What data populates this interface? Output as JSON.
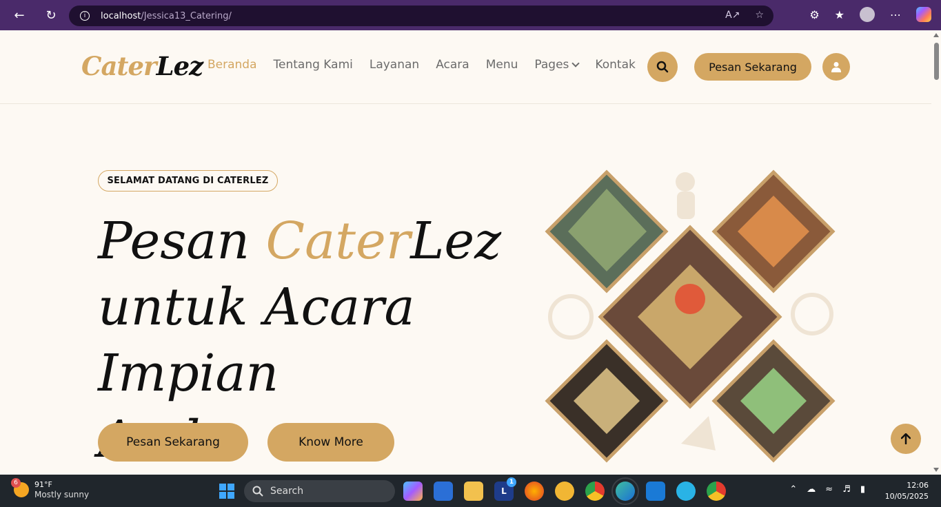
{
  "browser": {
    "url_host": "localhost",
    "url_path": "/Jessica13_Catering/"
  },
  "navbar": {
    "logo_part1": "Cater",
    "logo_part2": "Lez",
    "items": [
      {
        "label": "Beranda",
        "active": true
      },
      {
        "label": "Tentang Kami"
      },
      {
        "label": "Layanan"
      },
      {
        "label": "Acara"
      },
      {
        "label": "Menu"
      },
      {
        "label": "Pages",
        "dropdown": true
      },
      {
        "label": "Kontak"
      }
    ],
    "cta_label": "Pesan Sekarang"
  },
  "hero": {
    "welcome": "SELAMAT DATANG DI CATERLEZ",
    "title_line1_a": "Pesan ",
    "title_line1_gold": "Cater",
    "title_line1_b": "Lez",
    "title_line2": "untuk Acara Impian",
    "title_line3": "Anda",
    "btn_primary": "Pesan Sekarang",
    "btn_secondary": "Know More"
  },
  "taskbar": {
    "weather_temp": "91°F",
    "weather_condition": "Mostly sunny",
    "weather_badge": "6",
    "search_label": "Search",
    "time": "12:06",
    "date": "10/05/2025",
    "notification_badge": "1"
  },
  "colors": {
    "accent": "#d4a762",
    "background": "#fdf9f3",
    "text": "#111111"
  }
}
